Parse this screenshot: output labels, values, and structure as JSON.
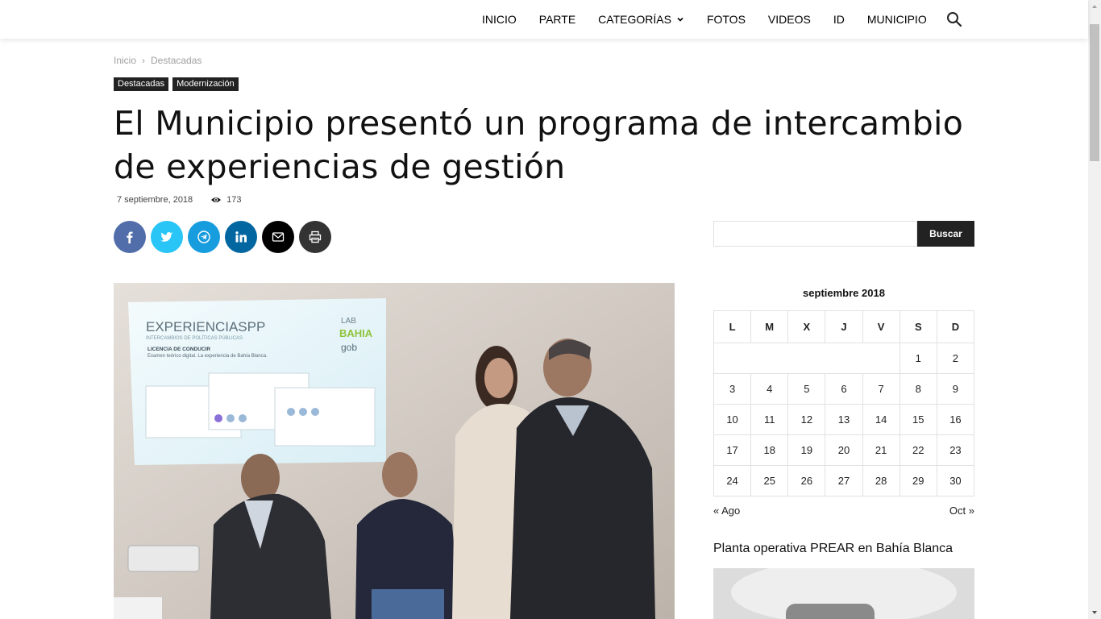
{
  "nav": {
    "items": [
      "INICIO",
      "PARTE",
      "CATEGORÍAS",
      "FOTOS",
      "VIDEOS",
      "ID",
      "MUNICIPIO"
    ],
    "search_icon": "search-icon"
  },
  "breadcrumb": {
    "home": "Inicio",
    "sep": "›",
    "current": "Destacadas"
  },
  "tags": [
    "Destacadas",
    "Modernización"
  ],
  "article": {
    "title": "El Municipio presentó un programa de intercambio de experiencias de gestión",
    "date": "7 septiembre, 2018",
    "views": "173"
  },
  "share": {
    "buttons": [
      {
        "name": "facebook",
        "color": "#516eab"
      },
      {
        "name": "twitter",
        "color": "#29c5f6"
      },
      {
        "name": "telegram",
        "color": "#179cde"
      },
      {
        "name": "linkedin",
        "color": "#0266a0"
      },
      {
        "name": "email",
        "color": "#000000"
      },
      {
        "name": "print",
        "color": "#333333"
      }
    ]
  },
  "hero": {
    "slide_title": "EXPERIENCIASPP",
    "slide_subtitle": "INTERCAMBIOS DE POLÍTICAS PÚBLICAS",
    "slide_line1": "LICENCIA DE CONDUCIR",
    "slide_line2": "Examen teórico digital. La experiencia de Bahía Blanca.",
    "logo_lab": "LAB",
    "logo_bahia": "BAHIA",
    "logo_gob": "gob"
  },
  "sidebar": {
    "search_placeholder": "",
    "search_button": "Buscar",
    "calendar": {
      "caption": "septiembre 2018",
      "weekdays": [
        "L",
        "M",
        "X",
        "J",
        "V",
        "S",
        "D"
      ],
      "weeks": [
        [
          "",
          "",
          "",
          "",
          "",
          "1",
          "2"
        ],
        [
          "3",
          "4",
          "5",
          "6",
          "7",
          "8",
          "9"
        ],
        [
          "10",
          "11",
          "12",
          "13",
          "14",
          "15",
          "16"
        ],
        [
          "17",
          "18",
          "19",
          "20",
          "21",
          "22",
          "23"
        ],
        [
          "24",
          "25",
          "26",
          "27",
          "28",
          "29",
          "30"
        ]
      ],
      "prev": "« Ago",
      "next": "Oct »"
    },
    "widget_title": "Planta operativa PREAR en Bahía Blanca"
  }
}
